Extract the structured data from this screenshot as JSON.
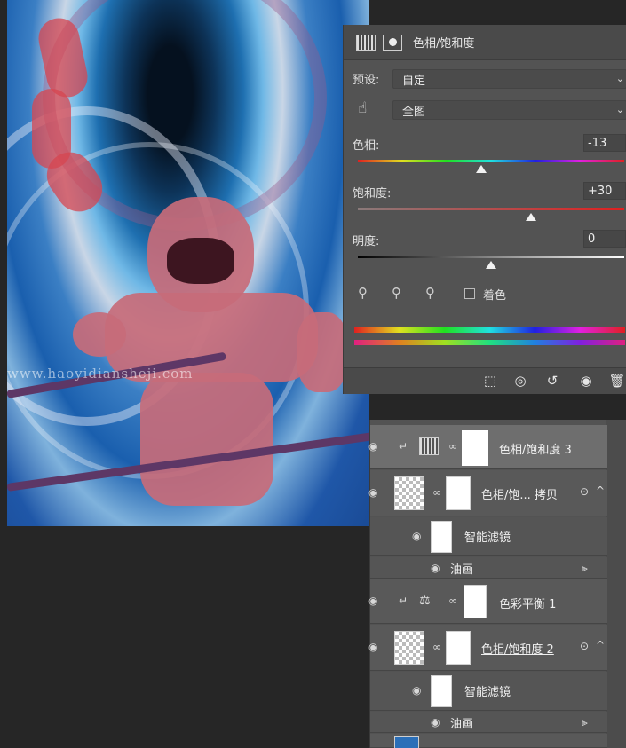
{
  "watermark": "www.haoyidiansheji.com",
  "properties": {
    "title": "色相/饱和度",
    "header_icons": [
      "adjustment-grid-icon",
      "mask-circle-icon"
    ],
    "preset_label": "预设:",
    "preset_value": "自定",
    "range_value": "全图",
    "hue_label": "色相:",
    "hue_value": "-13",
    "saturation_label": "饱和度:",
    "saturation_value": "+30",
    "lightness_label": "明度:",
    "lightness_value": "0",
    "colorize_label": "着色",
    "footer_icons": [
      "clip-to-layer-icon",
      "view-previous-icon",
      "reset-icon",
      "visibility-icon",
      "trash-icon"
    ],
    "slider_levels": {
      "hue": -13,
      "saturation": 30,
      "lightness": 0
    }
  },
  "layers": [
    {
      "name": "色相/饱和度 3",
      "selected": true
    },
    {
      "name": "色相/饱... 拷贝",
      "selected": false
    },
    {
      "name": "智能滤镜",
      "sub": true
    },
    {
      "name": "油画",
      "sub": true
    },
    {
      "name": "色彩平衡 1",
      "selected": false
    },
    {
      "name": "色相/饱和度 2",
      "selected": false
    },
    {
      "name": "智能滤镜",
      "sub": true
    },
    {
      "name": "油画",
      "sub": true
    }
  ],
  "colors": {
    "panel": "#535353",
    "selected_layer": "#6e6e6e",
    "mask_red": "#d64650"
  }
}
